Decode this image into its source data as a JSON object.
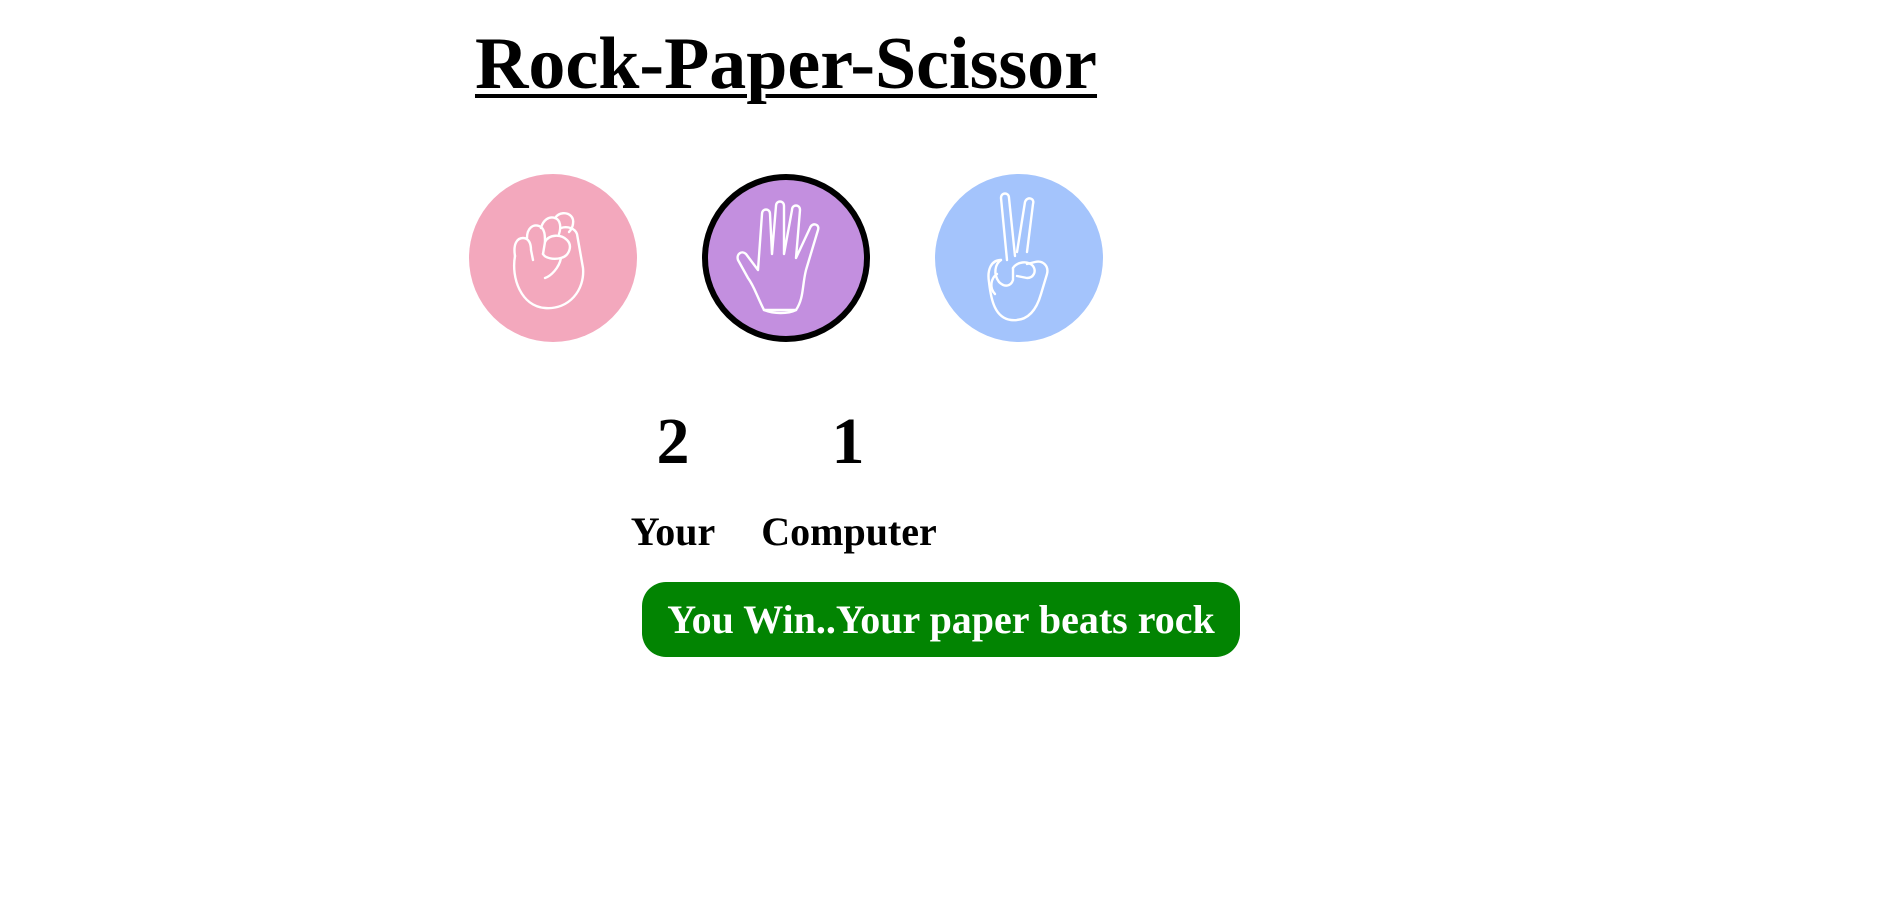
{
  "title": "Rock-Paper-Scissor",
  "choices": [
    {
      "id": "rock",
      "icon": "rock-fist-icon",
      "color": "#f3a8bd",
      "selected": false
    },
    {
      "id": "paper",
      "icon": "paper-hand-icon",
      "color": "#c38fdf",
      "selected": true
    },
    {
      "id": "scissor",
      "icon": "scissor-hand-icon",
      "color": "#a4c4fc",
      "selected": false
    }
  ],
  "score": {
    "user": "2",
    "computer": "1",
    "user_label": "Your",
    "computer_label": "Computer"
  },
  "message": {
    "text": "You Win..Your paper beats rock",
    "color": "#028402"
  }
}
